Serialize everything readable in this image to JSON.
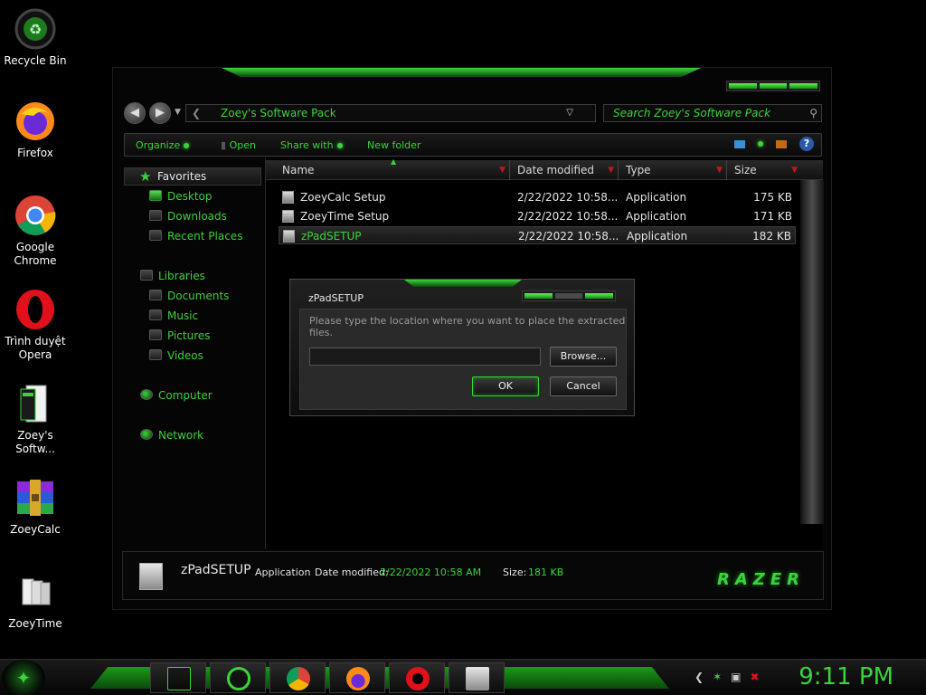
{
  "desktop": {
    "icons": [
      {
        "label": "Recycle Bin",
        "icon": "recycle-bin-icon"
      },
      {
        "label": "Firefox",
        "icon": "firefox-icon"
      },
      {
        "label": "Google Chrome",
        "icon": "chrome-icon"
      },
      {
        "label": "Trình duyệt Opera",
        "icon": "opera-icon"
      },
      {
        "label": "Zoey's Softw...",
        "icon": "package-folder-icon"
      },
      {
        "label": "ZoeyCalc",
        "icon": "winrar-archive-icon"
      },
      {
        "label": "ZoeyTime",
        "icon": "document-pages-icon"
      }
    ]
  },
  "explorer": {
    "address": "Zoey's Software Pack",
    "search_placeholder": "Search Zoey's Software Pack",
    "toolbar": {
      "organize": "Organize",
      "open": "Open",
      "share_with": "Share with",
      "new_folder": "New folder"
    },
    "sidebar": {
      "favorites": "Favorites",
      "desktop": "Desktop",
      "downloads": "Downloads",
      "recent_places": "Recent Places",
      "libraries": "Libraries",
      "documents": "Documents",
      "music": "Music",
      "pictures": "Pictures",
      "videos": "Videos",
      "computer": "Computer",
      "network": "Network"
    },
    "columns": {
      "name": "Name",
      "date_modified": "Date modified",
      "type": "Type",
      "size": "Size"
    },
    "files": [
      {
        "name": "ZoeyCalc Setup",
        "date": "2/22/2022 10:58...",
        "type": "Application",
        "size": "175 KB"
      },
      {
        "name": "ZoeyTime Setup",
        "date": "2/22/2022 10:58...",
        "type": "Application",
        "size": "171 KB"
      },
      {
        "name": "zPadSETUP",
        "date": "2/22/2022 10:58...",
        "type": "Application",
        "size": "182 KB"
      }
    ],
    "status": {
      "name": "zPadSETUP",
      "type_label": "Application",
      "date_label": "Date modified:",
      "date_value": "2/22/2022 10:58 AM",
      "size_label": "Size:",
      "size_value": "181 KB",
      "brand": "RAZER"
    }
  },
  "dialog": {
    "title": "zPadSETUP",
    "prompt": "Please type the location where you want to place the extracted files.",
    "path_value": "",
    "browse": "Browse...",
    "ok": "OK",
    "cancel": "Cancel"
  },
  "taskbar": {
    "clock": "9:11 PM"
  },
  "colors": {
    "accent": "#3bd33b",
    "background": "#000000",
    "sort_arrow": "#c0171d"
  }
}
